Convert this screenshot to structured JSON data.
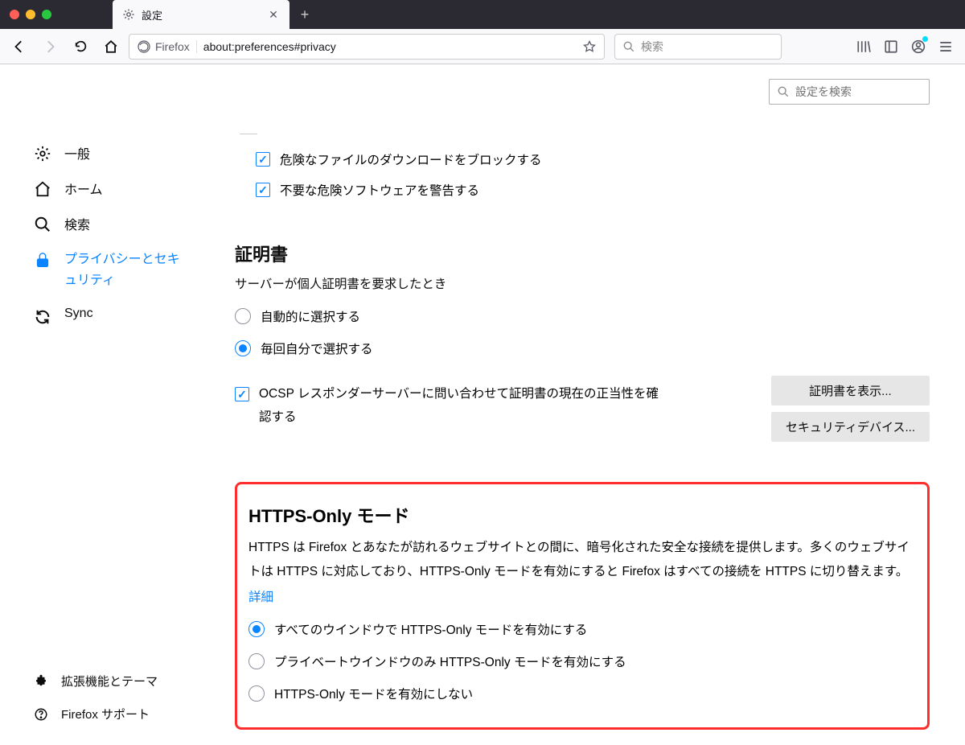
{
  "titlebar": {
    "tab_title": "設定"
  },
  "navbar": {
    "identity": "Firefox",
    "url": "about:preferences#privacy",
    "search_placeholder": "検索"
  },
  "search_settings_placeholder": "設定を検索",
  "sidebar": {
    "items": [
      {
        "label": "一般"
      },
      {
        "label": "ホーム"
      },
      {
        "label": "検索"
      },
      {
        "label": "プライバシーとセキュリティ"
      },
      {
        "label": "Sync"
      }
    ],
    "footer": [
      {
        "label": "拡張機能とテーマ"
      },
      {
        "label": "Firefox サポート"
      }
    ]
  },
  "checks": {
    "block_dangerous": "危険なファイルのダウンロードをブロックする",
    "warn_unwanted": "不要な危険ソフトウェアを警告する"
  },
  "cert": {
    "title": "証明書",
    "subtitle": "サーバーが個人証明書を要求したとき",
    "radio_auto": "自動的に選択する",
    "radio_manual": "毎回自分で選択する",
    "ocsp": "OCSP レスポンダーサーバーに問い合わせて証明書の現在の正当性を確認する",
    "btn_view": "証明書を表示...",
    "btn_devices": "セキュリティデバイス..."
  },
  "https": {
    "title": "HTTPS-Only モード",
    "desc": "HTTPS は Firefox とあなたが訪れるウェブサイトとの間に、暗号化された安全な接続を提供します。多くのウェブサイトは HTTPS に対応しており、HTTPS-Only モードを有効にすると Firefox はすべての接続を HTTPS に切り替えます。",
    "more": "詳細",
    "opt_all": "すべてのウインドウで HTTPS-Only モードを有効にする",
    "opt_private": "プライベートウインドウのみ HTTPS-Only モードを有効にする",
    "opt_off": "HTTPS-Only モードを有効にしない"
  }
}
